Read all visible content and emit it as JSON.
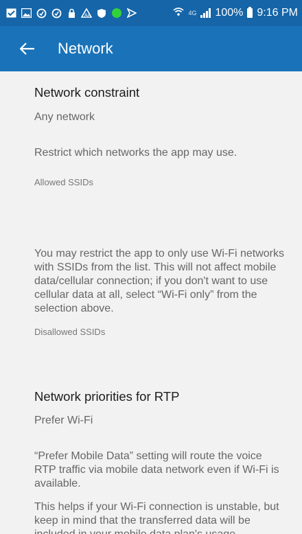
{
  "status_bar": {
    "network_type": "4G",
    "battery": "100%",
    "time": "9:16 PM"
  },
  "appbar": {
    "title": "Network"
  },
  "sections": {
    "constraint": {
      "title": "Network constraint",
      "value": "Any network",
      "description": "Restrict which networks the app may use."
    },
    "allowed_ssids": {
      "label": "Allowed SSIDs",
      "description": "You may restrict the app to only use Wi-Fi networks with SSIDs from the list. This will not affect mobile data/cellular connection; if you don't want to use cellular data at all, select “Wi-Fi only” from the selection above."
    },
    "disallowed_ssids": {
      "label": "Disallowed SSIDs"
    },
    "rtp_priorities": {
      "title": "Network priorities for RTP",
      "value": "Prefer Wi-Fi",
      "description_1": "“Prefer Mobile Data” setting will route the voice RTP traffic via mobile data network even if Wi-Fi is available.",
      "description_2": "This helps if your Wi-Fi connection is unstable, but keep in mind that the transferred data will be included in your mobile data plan's usage."
    }
  }
}
